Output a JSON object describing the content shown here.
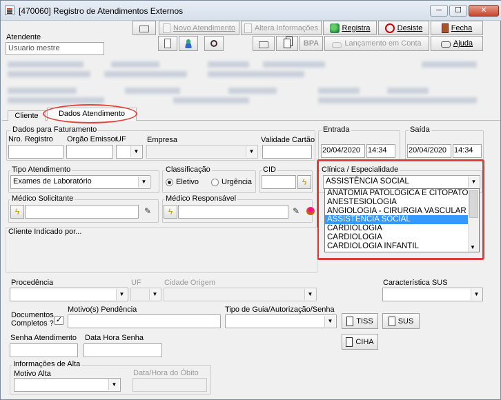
{
  "window": {
    "title": "[470060]  Registro de Atendimentos Externos",
    "minimize": "─",
    "maximize": "☐",
    "close": "✕"
  },
  "toolbar": {
    "novo_atendimento": "Novo Atendimento",
    "altera_informacoes": "Altera Informações",
    "registra": "Registra",
    "desiste": "Desiste",
    "fecha": "Fecha",
    "bpa": "BPA",
    "lancamento_conta": "Lançamento em Conta",
    "ajuda": "Ajuda"
  },
  "atendente": {
    "label": "Atendente",
    "value": "Usuario mestre"
  },
  "tabs": [
    {
      "label": "Cliente"
    },
    {
      "label": "Dados Atendimento"
    }
  ],
  "faturamento": {
    "group": "Dados para Faturamento",
    "nro_registro": "Nro. Registro",
    "orgao_emissor": "Orgão Emissor",
    "uf": "UF",
    "empresa": "Empresa",
    "validade_cartao": "Validade Cartão"
  },
  "entrada": {
    "group": "Entrada",
    "date": "20/04/2020",
    "time": "14:34"
  },
  "saida": {
    "group": "Saída",
    "date": "20/04/2020",
    "time": "14:34"
  },
  "tipo_atendimento": {
    "group": "Tipo Atendimento",
    "value": "Exames de Laboratório"
  },
  "classificacao": {
    "group": "Classificação",
    "eletivo": "Eletivo",
    "urgencia": "Urgência",
    "selected": "Eletivo"
  },
  "cid": {
    "group": "CID"
  },
  "clinica": {
    "group": "Clínica / Especialidade",
    "value": "ASSISTÊNCIA SOCIAL",
    "options": [
      "ANATOMIA PATOLÓGICA E CITOPATOLO",
      "ANESTESIOLOGIA",
      "ANGIOLOGIA - CIRURGIA VASCULAR E L",
      "ASSISTÊNCIA SOCIAL",
      "CARDIOLOGIA",
      "CARDIOLOGIA",
      "CARDIOLOGIA INFANTIL"
    ],
    "selected_index": 3
  },
  "medico_solicitante": {
    "group": "Médico Solicitante"
  },
  "medico_responsavel": {
    "group": "Médico Responsável"
  },
  "cliente_indicado": {
    "label": "Cliente Indicado por..."
  },
  "procedencia": {
    "label": "Procedência",
    "uf": "UF",
    "cidade_origem": "Cidade Origem"
  },
  "caracteristica_sus": {
    "label": "Característica SUS"
  },
  "documentos": {
    "label_line1": "Documentos",
    "label_line2": "Completos ?",
    "checked": true,
    "check_mark": "✓"
  },
  "motivo_pendencia": {
    "label": "Motivo(s) Pendência"
  },
  "tipo_guia": {
    "label": "Tipo de Guia/Autorização/Senha"
  },
  "buttons": {
    "tiss": "TISS",
    "sus": "SUS",
    "ciha": "CIHA"
  },
  "senha_atendimento": {
    "label": "Senha Atendimento"
  },
  "data_hora_senha": {
    "label": "Data Hora Senha"
  },
  "alta": {
    "group": "Informações de Alta",
    "motivo_alta": "Motivo Alta",
    "data_hora_obito": "Data/Hora do Óbito"
  },
  "colors": {
    "highlight": "#e03b3b",
    "selection": "#3399ff"
  }
}
